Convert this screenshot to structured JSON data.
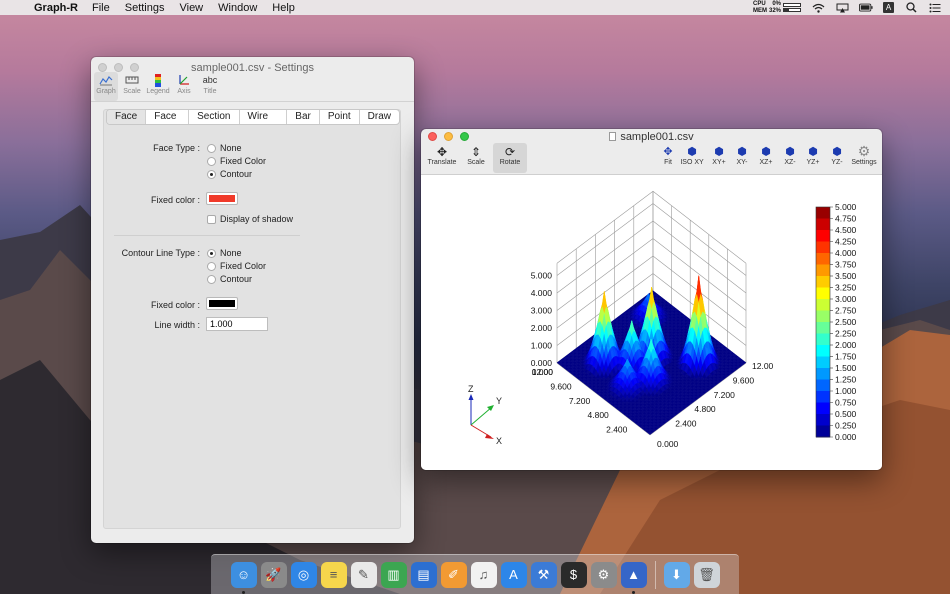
{
  "menubar": {
    "app_name": "Graph-R",
    "menus": [
      "File",
      "Settings",
      "View",
      "Window",
      "Help"
    ],
    "cpu_label": "CPU",
    "mem_label": "MEM",
    "cpu_value": "0%",
    "mem_value": "32%",
    "cpu_fraction": 0.0,
    "mem_fraction": 0.32,
    "input_source": "A"
  },
  "settings_window": {
    "title": "sample001.csv - Settings",
    "toolbar": [
      {
        "label": "Graph",
        "icon": "graph-icon",
        "glyph": "⌇"
      },
      {
        "label": "Scale",
        "icon": "scale-icon",
        "glyph": "▭"
      },
      {
        "label": "Legend",
        "icon": "legend-icon",
        "glyph": "▮"
      },
      {
        "label": "Axis",
        "icon": "axis-icon",
        "glyph": "⟋"
      },
      {
        "label": "Title",
        "icon": "title-icon",
        "glyph": "abc"
      }
    ],
    "tabs": [
      "Face",
      "Face Line",
      "Section",
      "Wire Frame",
      "Bar",
      "Point",
      "Draw"
    ],
    "face_type_label": "Face Type :",
    "face_type_options": [
      "None",
      "Fixed Color",
      "Contour"
    ],
    "face_type_selected": 2,
    "fixed_color_label": "Fixed color :",
    "fixed_color_value": "#f03a2a",
    "shadow_label": "Display of shadow",
    "contour_line_type_label": "Contour Line Type :",
    "contour_line_options": [
      "None",
      "Fixed Color",
      "Contour"
    ],
    "contour_line_selected": 0,
    "line_fixed_color_label": "Fixed color :",
    "line_fixed_color_value": "#000000",
    "line_width_label": "Line width :",
    "line_width_value": "1.000"
  },
  "graph_window": {
    "title": "sample001.csv",
    "tools_left": [
      {
        "label": "Translate",
        "icon": "translate-icon",
        "glyph": "✥"
      },
      {
        "label": "Scale",
        "icon": "scale-tool-icon",
        "glyph": "⇕"
      },
      {
        "label": "Rotate",
        "icon": "rotate-icon",
        "glyph": "⟳"
      }
    ],
    "tools_right": [
      {
        "label": "Fit",
        "icon": "fit-icon",
        "glyph": "✥"
      },
      {
        "label": "ISO XY",
        "icon": "cube-iso-xy-icon",
        "glyph": "⬢"
      },
      {
        "label": "XY+",
        "icon": "cube-xy-plus-icon",
        "glyph": "⬢"
      },
      {
        "label": "XY-",
        "icon": "cube-xy-minus-icon",
        "glyph": "⬢"
      },
      {
        "label": "XZ+",
        "icon": "cube-xz-plus-icon",
        "glyph": "⬢"
      },
      {
        "label": "XZ-",
        "icon": "cube-xz-minus-icon",
        "glyph": "⬢"
      },
      {
        "label": "YZ+",
        "icon": "cube-yz-plus-icon",
        "glyph": "⬢"
      },
      {
        "label": "YZ-",
        "icon": "cube-yz-minus-icon",
        "glyph": "⬢"
      },
      {
        "label": "Settings",
        "icon": "settings-gear-icon",
        "glyph": "⚙"
      }
    ],
    "triad": {
      "x": "X",
      "y": "Y",
      "z": "Z"
    }
  },
  "chart_data": {
    "type": "surface3d",
    "z_ticks": [
      "0.000",
      "1.000",
      "2.000",
      "3.000",
      "4.000",
      "5.000"
    ],
    "x_ticks": [
      "0.000",
      "2.400",
      "4.800",
      "7.200",
      "9.600",
      "12.00"
    ],
    "y_ticks": [
      "0.000",
      "2.400",
      "4.800",
      "7.200",
      "9.600",
      "12.00"
    ],
    "xlim": [
      0,
      12
    ],
    "ylim": [
      0,
      12
    ],
    "zlim": [
      0,
      5
    ],
    "legend_ticks": [
      "5.000",
      "4.750",
      "4.500",
      "4.250",
      "4.000",
      "3.750",
      "3.500",
      "3.250",
      "3.000",
      "2.750",
      "2.500",
      "2.250",
      "2.000",
      "1.750",
      "1.500",
      "1.250",
      "1.000",
      "0.750",
      "0.500",
      "0.250",
      "0.000"
    ],
    "legend_placement": "right",
    "grid": true,
    "peaks": [
      {
        "x": 3.0,
        "y": 9.0,
        "z": 5.0
      },
      {
        "x": 9.0,
        "y": 3.0,
        "z": 4.1
      },
      {
        "x": 6.5,
        "y": 6.5,
        "z": 4.0
      },
      {
        "x": 7.0,
        "y": 4.5,
        "z": 2.6
      },
      {
        "x": 4.5,
        "y": 4.5,
        "z": 2.4
      },
      {
        "x": 5.5,
        "y": 2.5,
        "z": 1.6
      },
      {
        "x": 10.0,
        "y": 9.5,
        "z": 1.4
      }
    ]
  },
  "dock": [
    {
      "name": "finder-icon",
      "glyph": "☺",
      "color": "#3d8fe0",
      "running": true
    },
    {
      "name": "launchpad-icon",
      "glyph": "🚀",
      "color": "#8a8a8a",
      "running": false
    },
    {
      "name": "safari-icon",
      "glyph": "◎",
      "color": "#2f86e6",
      "running": false
    },
    {
      "name": "notes-icon",
      "glyph": "≡",
      "color": "#f6d64c",
      "running": false
    },
    {
      "name": "textedit-icon",
      "glyph": "✎",
      "color": "#e9e9e9",
      "running": false
    },
    {
      "name": "numbers-icon",
      "glyph": "▥",
      "color": "#3ca651",
      "running": false
    },
    {
      "name": "keynote-icon",
      "glyph": "▤",
      "color": "#2c6fd1",
      "running": false
    },
    {
      "name": "pages-icon",
      "glyph": "✐",
      "color": "#f29a32",
      "running": false
    },
    {
      "name": "itunes-icon",
      "glyph": "♫",
      "color": "#f2f2f2",
      "running": false
    },
    {
      "name": "app-store-icon",
      "glyph": "A",
      "color": "#2d86e8",
      "running": false
    },
    {
      "name": "xcode-icon",
      "glyph": "⚒",
      "color": "#3b7bd6",
      "running": false
    },
    {
      "name": "terminal-icon",
      "glyph": "$",
      "color": "#2a2a2a",
      "running": false
    },
    {
      "name": "system-preferences-icon",
      "glyph": "⚙",
      "color": "#8b8b8b",
      "running": false
    },
    {
      "name": "graph-r-icon",
      "glyph": "▲",
      "color": "#3566c8",
      "running": true
    },
    {
      "name": "downloads-folder-icon",
      "glyph": "⬇",
      "color": "#62a9e8",
      "running": false
    },
    {
      "name": "trash-icon",
      "glyph": "🗑",
      "color": "#cfd4d9",
      "running": false
    }
  ]
}
